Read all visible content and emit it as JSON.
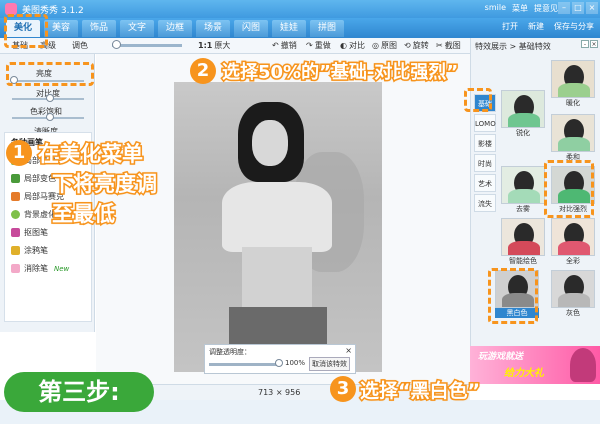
{
  "app": {
    "title": "美图秀秀 3.1.2",
    "account": "smile",
    "menu": "菜单",
    "feedback": "提意见"
  },
  "tabs": [
    "美化",
    "美容",
    "饰品",
    "文字",
    "边框",
    "场景",
    "闪图",
    "娃娃",
    "拼图"
  ],
  "active_tab": "美化",
  "top_actions": {
    "open": "打开",
    "new": "新建",
    "save": "保存与分享"
  },
  "subtabs": [
    "基础",
    "高级",
    "调色"
  ],
  "toolbar": {
    "zoom_label": "原大",
    "zoom_prefix": "1:1",
    "undo": "撤销",
    "redo": "重做",
    "compare": "对比",
    "original": "原图",
    "rotate": "旋转",
    "crop": "截图",
    "size": "尺寸"
  },
  "adjust": {
    "brightness": "亮度",
    "contrast": "对比度",
    "saturation": "色彩饱和",
    "sharpness": "清晰度"
  },
  "brushes": {
    "header": "各种画笔",
    "items": [
      "局部美白",
      "局部变色",
      "局部马赛克",
      "背景虚化",
      "抠图笔",
      "涂鸦笔",
      "消除笔"
    ],
    "new_badge": "New"
  },
  "opacity_dialog": {
    "title": "调整透明度：",
    "value": "100%",
    "cancel": "取消该特效"
  },
  "status": {
    "dims": "713 × 956"
  },
  "effects": {
    "header": "特效展示 > 基础特效",
    "categories": [
      "基础",
      "LOMO",
      "影楼",
      "时尚",
      "艺术",
      "流失"
    ],
    "thumbs": [
      "锐化",
      "暖化",
      "柔和",
      "去雾",
      "对比强烈",
      "智能绘色",
      "全彩",
      "黑白色",
      "灰色"
    ]
  },
  "ad": {
    "line1": "玩游戏就送",
    "line2": "给力大礼"
  },
  "annotations": {
    "step1_num": "1",
    "step1_text_a": "在美化菜单",
    "step1_text_b": "下将亮度调",
    "step1_text_c": "至最低",
    "step2_num": "2",
    "step2_text": "选择50%的”基础-对比强烈”",
    "step3_num": "3",
    "step3_text": "选择“黑白色”",
    "step_banner": "第三步:"
  },
  "colors": {
    "accent": "#f7941d",
    "brand": "#2f86cf",
    "banner": "#3aa83a"
  }
}
